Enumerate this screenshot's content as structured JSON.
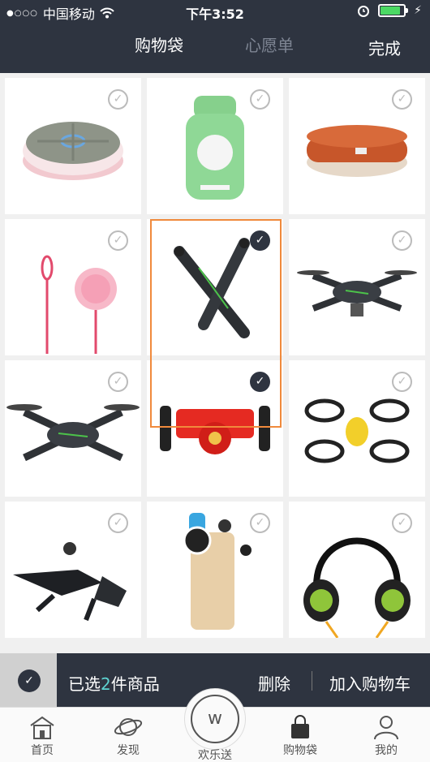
{
  "status_bar": {
    "carrier": "中国移动",
    "time": "下午3:52"
  },
  "header": {
    "tabs": [
      {
        "label": "购物袋",
        "active": true
      },
      {
        "label": "心愿单",
        "active": false
      }
    ],
    "done_label": "完成"
  },
  "products": [
    {
      "icon": "round-gray-power-bank",
      "checked": false
    },
    {
      "icon": "milk-bottle-power-bank",
      "checked": false
    },
    {
      "icon": "orange-round-power-bank",
      "checked": false
    },
    {
      "icon": "pink-sim-tool",
      "checked": false
    },
    {
      "icon": "x-shaped-drone",
      "checked": true
    },
    {
      "icon": "quadcopter-drone",
      "checked": false
    },
    {
      "icon": "black-quadcopter",
      "checked": false
    },
    {
      "icon": "red-jumping-robot",
      "checked": true
    },
    {
      "icon": "yellow-mini-drone",
      "checked": false
    },
    {
      "icon": "hydrofoil-drone",
      "checked": false
    },
    {
      "icon": "phone-with-lens",
      "checked": false
    },
    {
      "icon": "green-headphones",
      "checked": false
    }
  ],
  "action_bar": {
    "selected_prefix": "已选",
    "selected_count": "2",
    "selected_suffix": "件商品",
    "delete_label": "删除",
    "add_to_cart_label": "加入购物车"
  },
  "bottom_nav": [
    {
      "label": "首页",
      "icon": "home-icon"
    },
    {
      "label": "发现",
      "icon": "planet-icon"
    },
    {
      "label": "欢乐送",
      "icon": "w-logo-icon"
    },
    {
      "label": "购物袋",
      "icon": "bag-icon"
    },
    {
      "label": "我的",
      "icon": "person-icon"
    }
  ],
  "colors": {
    "header_bg": "#2e3440",
    "accent": "#5ed3d1",
    "highlight_border": "#f08a3c",
    "battery": "#4cd964"
  }
}
